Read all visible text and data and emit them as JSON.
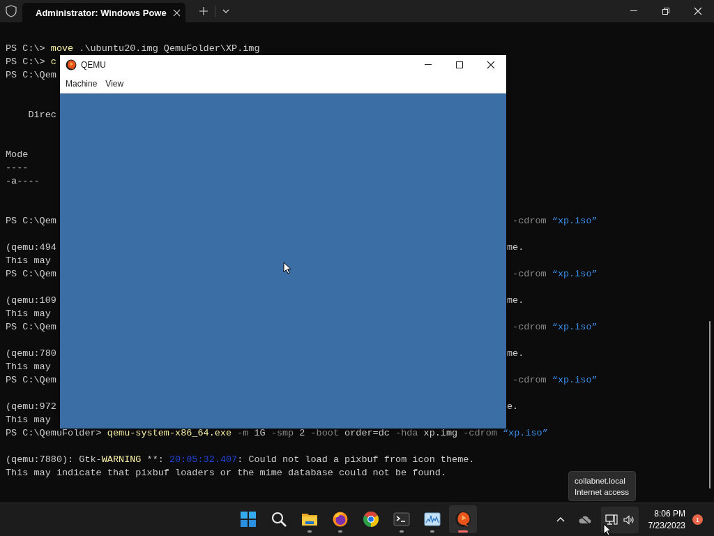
{
  "terminal": {
    "tab": {
      "title": "Administrator: Windows Powe",
      "selected": true
    },
    "lines": [
      {
        "kind": "text",
        "left": [
          {
            "kind": "plain",
            "text": "PS C:\\> "
          },
          {
            "kind": "command",
            "text": "move"
          },
          {
            "kind": "plain",
            "text": " .\\ubuntu20.img QemuFolder\\XP.img"
          }
        ]
      },
      {
        "kind": "text",
        "left": [
          {
            "kind": "plain",
            "text": "PS C:\\> "
          },
          {
            "kind": "command",
            "text": "c"
          }
        ]
      },
      {
        "kind": "text",
        "left": [
          {
            "kind": "plain",
            "text": "PS C:\\Qem"
          }
        ]
      },
      {
        "kind": "blank"
      },
      {
        "kind": "blank"
      },
      {
        "kind": "text",
        "left": [
          {
            "kind": "plain",
            "text": "    Direc"
          }
        ]
      },
      {
        "kind": "blank"
      },
      {
        "kind": "blank"
      },
      {
        "kind": "text",
        "left": [
          {
            "kind": "plain",
            "text": "Mode"
          }
        ]
      },
      {
        "kind": "text",
        "left": [
          {
            "kind": "plain",
            "text": "----"
          }
        ]
      },
      {
        "kind": "text",
        "left": [
          {
            "kind": "plain",
            "text": "-a----"
          }
        ]
      },
      {
        "kind": "blank"
      },
      {
        "kind": "blank"
      },
      {
        "kind": "text",
        "left": [
          {
            "kind": "plain",
            "text": "PS C:\\Qem"
          }
        ],
        "right": [
          {
            "kind": "param",
            "text": " -cdrom"
          },
          {
            "kind": "string",
            "text": " “xp.iso”"
          }
        ]
      },
      {
        "kind": "blank"
      },
      {
        "kind": "text",
        "left": [
          {
            "kind": "plain",
            "text": "(qemu:494"
          }
        ],
        "right": [
          {
            "kind": "plain",
            "text": "me."
          }
        ]
      },
      {
        "kind": "text",
        "left": [
          {
            "kind": "plain",
            "text": "This may"
          }
        ]
      },
      {
        "kind": "text",
        "left": [
          {
            "kind": "plain",
            "text": "PS C:\\Qem"
          }
        ],
        "right": [
          {
            "kind": "param",
            "text": " -cdrom"
          },
          {
            "kind": "string",
            "text": " “xp.iso”"
          }
        ]
      },
      {
        "kind": "blank"
      },
      {
        "kind": "text",
        "left": [
          {
            "kind": "plain",
            "text": "(qemu:109"
          }
        ],
        "right": [
          {
            "kind": "plain",
            "text": "me."
          }
        ]
      },
      {
        "kind": "text",
        "left": [
          {
            "kind": "plain",
            "text": "This may"
          }
        ]
      },
      {
        "kind": "text",
        "left": [
          {
            "kind": "plain",
            "text": "PS C:\\Qem"
          }
        ],
        "right": [
          {
            "kind": "param",
            "text": " -cdrom"
          },
          {
            "kind": "string",
            "text": " “xp.iso”"
          }
        ]
      },
      {
        "kind": "blank"
      },
      {
        "kind": "text",
        "left": [
          {
            "kind": "plain",
            "text": "(qemu:780"
          }
        ],
        "right": [
          {
            "kind": "plain",
            "text": "me."
          }
        ]
      },
      {
        "kind": "text",
        "left": [
          {
            "kind": "plain",
            "text": "This may"
          }
        ]
      },
      {
        "kind": "text",
        "left": [
          {
            "kind": "plain",
            "text": "PS C:\\Qem"
          }
        ],
        "right": [
          {
            "kind": "param",
            "text": " -cdrom"
          },
          {
            "kind": "string",
            "text": " “xp.iso”"
          }
        ]
      },
      {
        "kind": "blank"
      },
      {
        "kind": "text",
        "left": [
          {
            "kind": "plain",
            "text": "(qemu:972"
          }
        ],
        "right": [
          {
            "kind": "plain",
            "text": "e."
          }
        ]
      },
      {
        "kind": "text",
        "left": [
          {
            "kind": "plain",
            "text": "This may"
          }
        ]
      },
      {
        "kind": "text",
        "left": [
          {
            "kind": "plain",
            "text": "PS C:\\QemuFolder> "
          },
          {
            "kind": "command",
            "text": "qemu-system-x86_64.exe"
          },
          {
            "kind": "param",
            "text": " -m"
          },
          {
            "kind": "plain",
            "text": " 1G"
          },
          {
            "kind": "param",
            "text": " -smp"
          },
          {
            "kind": "plain",
            "text": " 2"
          },
          {
            "kind": "param",
            "text": " -boot"
          },
          {
            "kind": "plain",
            "text": " order=dc"
          },
          {
            "kind": "param",
            "text": " -hda"
          },
          {
            "kind": "plain",
            "text": " xp.img"
          },
          {
            "kind": "param",
            "text": " -cdrom"
          },
          {
            "kind": "string",
            "text": " “xp.iso”"
          }
        ]
      },
      {
        "kind": "blank"
      },
      {
        "kind": "text",
        "left": [
          {
            "kind": "plain",
            "text": "(qemu:7880): Gtk-"
          },
          {
            "kind": "warning",
            "text": "WARNING"
          },
          {
            "kind": "plain",
            "text": " **: "
          },
          {
            "kind": "timestamp",
            "text": "20:05:32.407"
          },
          {
            "kind": "plain",
            "text": ": Could not load a pixbuf from icon theme."
          }
        ]
      },
      {
        "kind": "text",
        "left": [
          {
            "kind": "plain",
            "text": "This may indicate that pixbuf loaders or the mime database could not be found."
          }
        ]
      }
    ]
  },
  "qemu_window": {
    "title": "QEMU",
    "menu": [
      {
        "label": "Machine"
      },
      {
        "label": "View"
      }
    ]
  },
  "tooltip": {
    "lines": [
      "collabnet.local",
      "Internet access"
    ]
  },
  "taskbar": {
    "apps": [
      {
        "kind": "start",
        "running": false,
        "active": false
      },
      {
        "kind": "search",
        "running": false,
        "active": false
      },
      {
        "kind": "files",
        "running": true,
        "active": false
      },
      {
        "kind": "firefox",
        "running": true,
        "active": false
      },
      {
        "kind": "chrome",
        "running": false,
        "active": false
      },
      {
        "kind": "terminal",
        "running": true,
        "active": false
      },
      {
        "kind": "monitor",
        "running": true,
        "active": false
      },
      {
        "kind": "qemu",
        "running": true,
        "active": true
      }
    ],
    "time": "8:06 PM",
    "date": "7/23/2023",
    "notification_count": "1"
  }
}
